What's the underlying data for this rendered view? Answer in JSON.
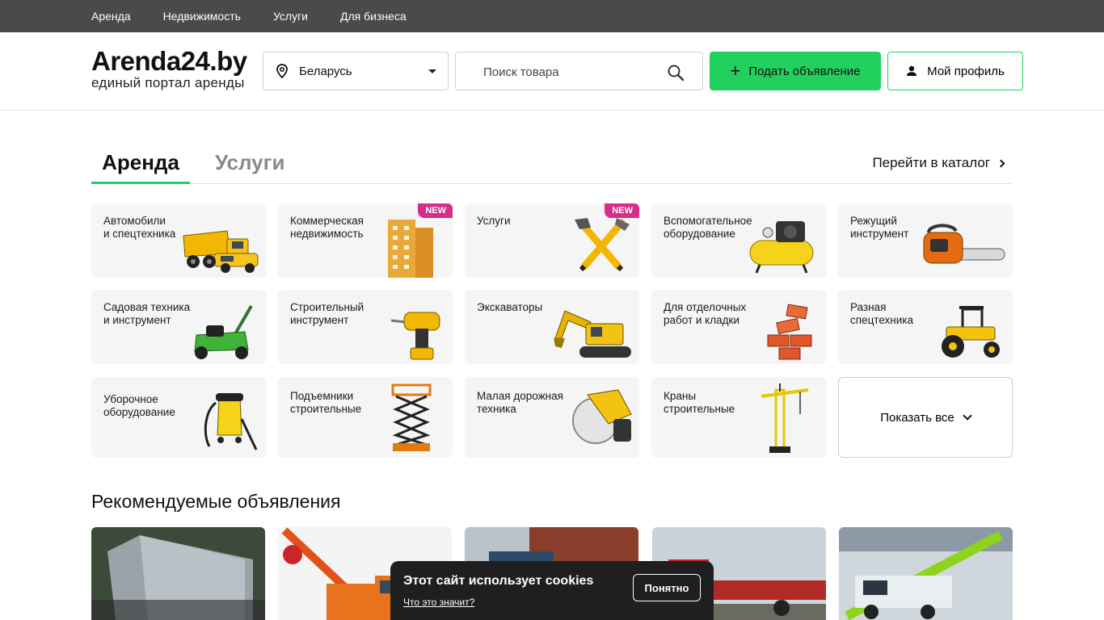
{
  "topbar": {
    "links": [
      "Аренда",
      "Недвижимость",
      "Услуги",
      "Для бизнеса"
    ]
  },
  "header": {
    "logo_title": "Arenda24.by",
    "logo_subtitle": "единый портал аренды",
    "region": "Беларусь",
    "search_placeholder": "Поиск товара",
    "post_button": "Подать объявление",
    "profile_button": "Мой профиль"
  },
  "tabs": {
    "active": "Аренда",
    "inactive": "Услуги",
    "catalog_link": "Перейти в каталог"
  },
  "categories": [
    {
      "label": "Автомобили\nи спецтехника",
      "icon": "dump-truck-icon",
      "badge": ""
    },
    {
      "label": "Коммерческая\nнедвижимость",
      "icon": "building-icon",
      "badge": "NEW"
    },
    {
      "label": "Услуги",
      "icon": "hammer-wrench-icon",
      "badge": "NEW"
    },
    {
      "label": "Вспомогательное\nоборудование",
      "icon": "compressor-icon",
      "badge": ""
    },
    {
      "label": "Режущий\nинструмент",
      "icon": "chainsaw-icon",
      "badge": ""
    },
    {
      "label": "Садовая техника\nи инструмент",
      "icon": "lawnmower-icon",
      "badge": ""
    },
    {
      "label": "Строительный\nинструмент",
      "icon": "drill-icon",
      "badge": ""
    },
    {
      "label": "Экскаваторы",
      "icon": "excavator-icon",
      "badge": ""
    },
    {
      "label": "Для отделочных\nработ и кладки",
      "icon": "bricks-icon",
      "badge": ""
    },
    {
      "label": "Разная\nспецтехника",
      "icon": "tractor-icon",
      "badge": ""
    },
    {
      "label": "Уборочное\nоборудование",
      "icon": "vacuum-icon",
      "badge": ""
    },
    {
      "label": "Подъемники\nстроительные",
      "icon": "scissor-lift-icon",
      "badge": ""
    },
    {
      "label": "Малая дорожная\nтехника",
      "icon": "cutter-icon",
      "badge": ""
    },
    {
      "label": "Краны\nстроительные",
      "icon": "tower-crane-icon",
      "badge": ""
    }
  ],
  "show_all": "Показать все",
  "recommended_title": "Рекомендуемые объявления",
  "cookie": {
    "title": "Этот сайт использует cookies",
    "link": "Что это значит?",
    "button": "Понятно"
  },
  "colors": {
    "accent": "#22d15d",
    "topbar": "#4a4a4a",
    "badge": "#d92d8a"
  }
}
